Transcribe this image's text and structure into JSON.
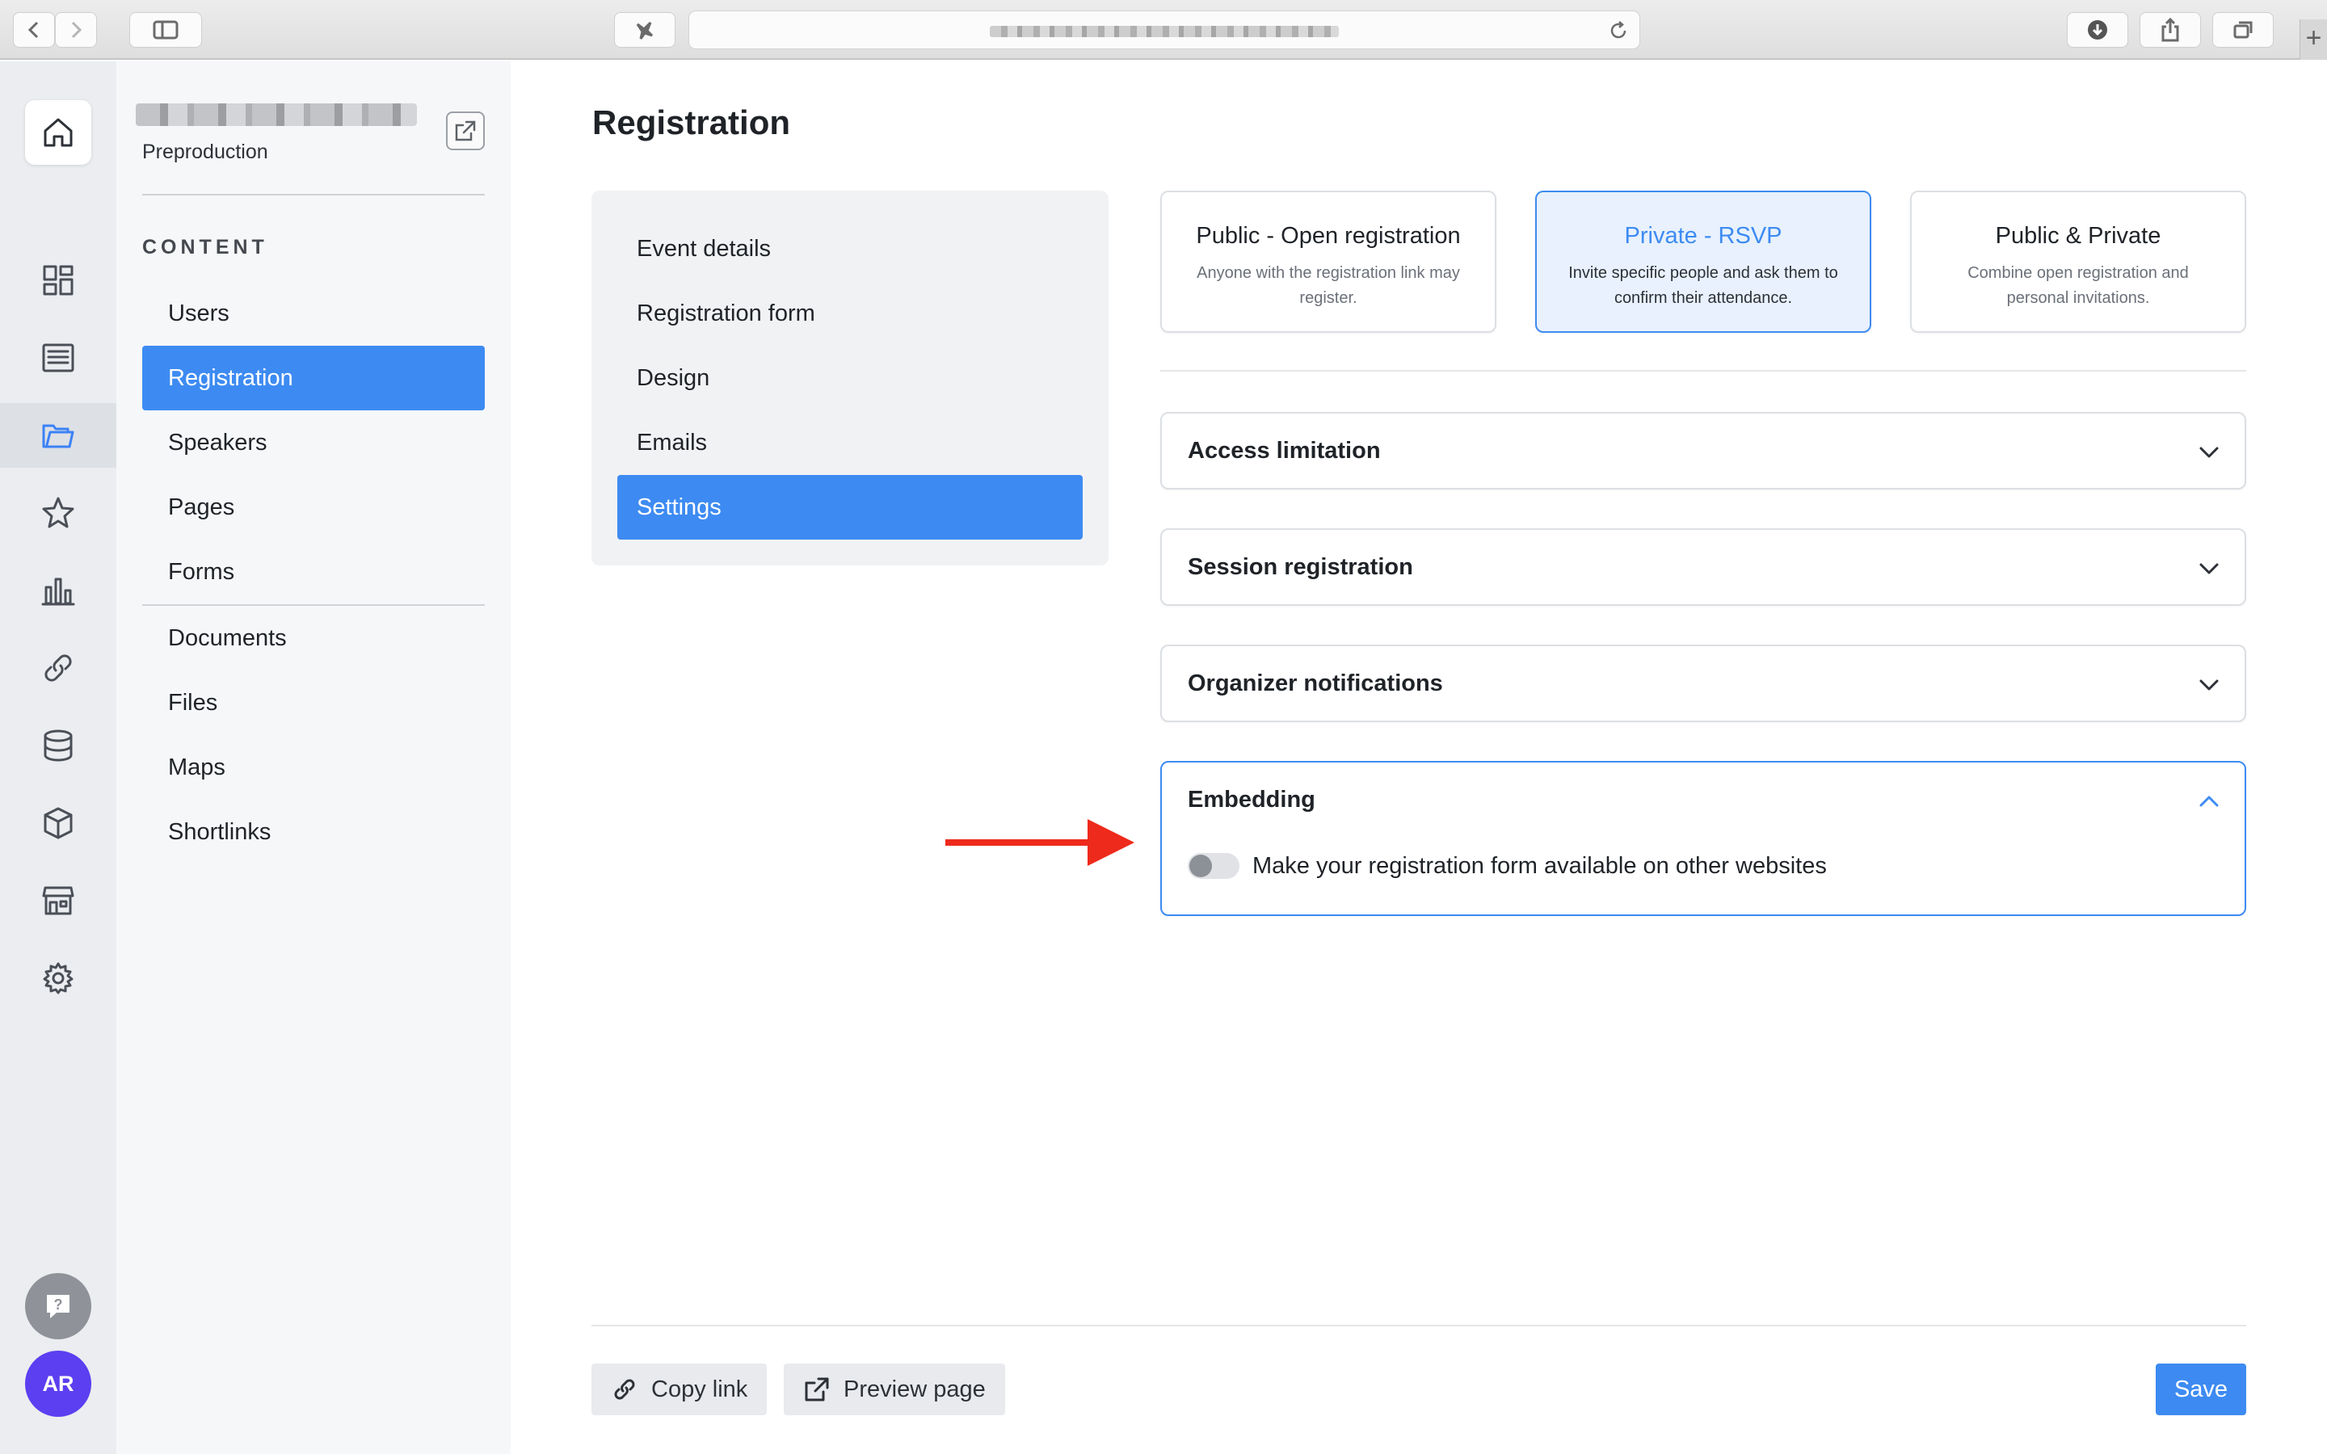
{
  "browser": {
    "url_text": ""
  },
  "rail": {
    "items": [
      "home-icon",
      "dashboard-icon",
      "news-icon",
      "folder-icon",
      "star-icon",
      "analytics-icon",
      "link-icon",
      "database-icon",
      "package-icon",
      "store-icon",
      "settings-icon"
    ],
    "active": "folder-icon",
    "user_initials": "AR"
  },
  "sidebar": {
    "project_environment": "Preproduction",
    "section_title": "CONTENT",
    "items": [
      {
        "label": "Users"
      },
      {
        "label": "Registration",
        "active": true
      },
      {
        "label": "Speakers"
      },
      {
        "label": "Pages"
      },
      {
        "label": "Forms"
      },
      {
        "label": "Documents"
      },
      {
        "label": "Files"
      },
      {
        "label": "Maps"
      },
      {
        "label": "Shortlinks"
      }
    ]
  },
  "main": {
    "title": "Registration",
    "subnav": [
      {
        "label": "Event details"
      },
      {
        "label": "Registration form"
      },
      {
        "label": "Design"
      },
      {
        "label": "Emails"
      },
      {
        "label": "Settings",
        "active": true
      }
    ],
    "registration_types": [
      {
        "title": "Public - Open registration",
        "description": "Anyone with the registration link may register."
      },
      {
        "title": "Private - RSVP",
        "description": "Invite specific people and ask them to confirm their attendance.",
        "selected": true
      },
      {
        "title": "Public & Private",
        "description": "Combine open registration and personal invitations."
      }
    ],
    "sections": [
      {
        "title": "Access limitation",
        "open": false
      },
      {
        "title": "Session registration",
        "open": false
      },
      {
        "title": "Organizer notifications",
        "open": false
      },
      {
        "title": "Embedding",
        "open": true
      }
    ],
    "embedding": {
      "toggle_label": "Make your registration form available on other websites",
      "enabled": false
    }
  },
  "footer": {
    "copy_link_label": "Copy link",
    "preview_label": "Preview page",
    "save_label": "Save"
  },
  "colors": {
    "accent": "#3d8bf2",
    "annotation_arrow": "#ee2a1c",
    "avatar": "#5b3ff0"
  }
}
